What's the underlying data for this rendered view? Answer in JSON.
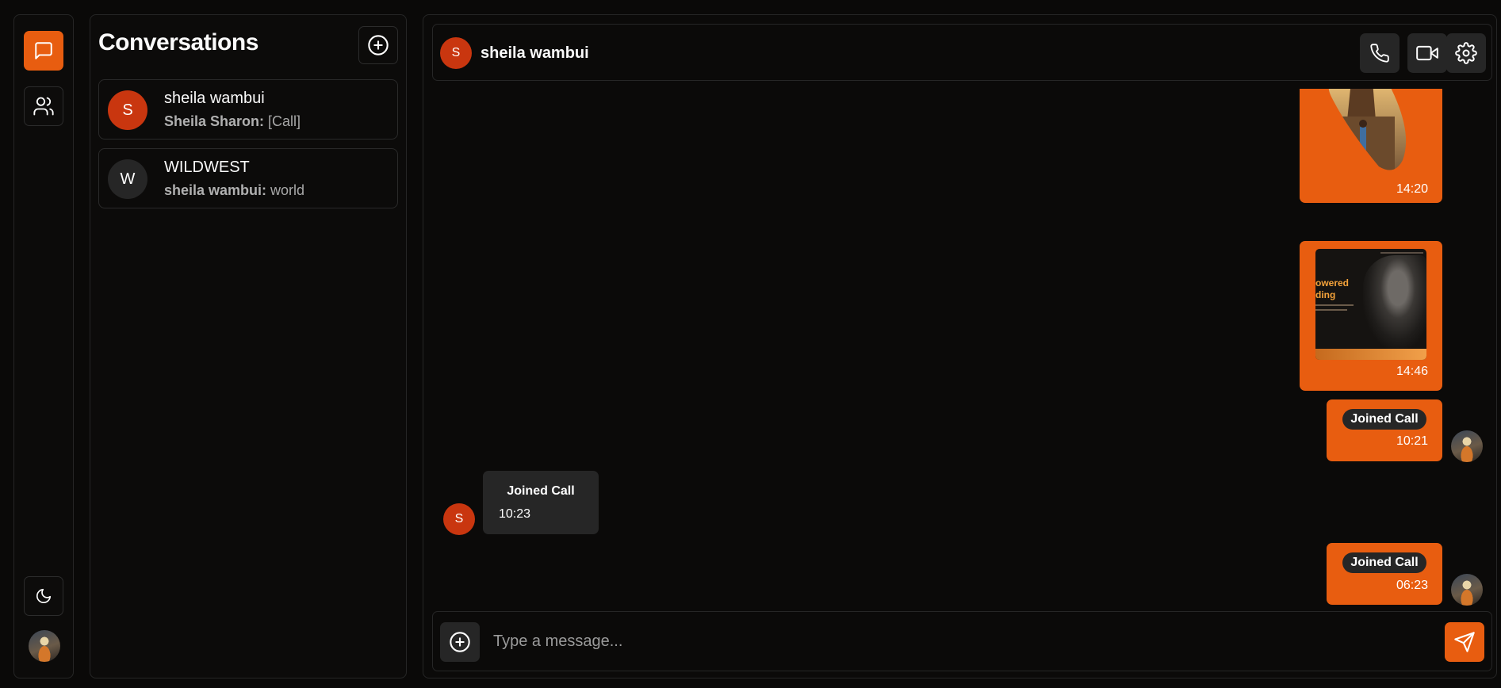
{
  "sidebar": {
    "items": [
      {
        "icon": "message-square-icon",
        "active": true
      },
      {
        "icon": "users-icon",
        "active": false
      }
    ],
    "theme_toggle_icon": "moon-icon",
    "user_avatar": "avatar-image"
  },
  "conversations": {
    "title": "Conversations",
    "add_icon": "plus-circle-icon",
    "items": [
      {
        "initial": "S",
        "name": "sheila wambui",
        "sender": "Sheila Sharon:",
        "preview": " [Call]",
        "avatar_color": "#c9360f"
      },
      {
        "initial": "W",
        "name": "WILDWEST",
        "sender": "sheila wambui:",
        "preview": " world",
        "avatar_color": "#262626"
      }
    ]
  },
  "chat": {
    "header": {
      "initial": "S",
      "name": "sheila wambui",
      "actions": [
        "phone-icon",
        "video-icon",
        "settings-icon"
      ]
    },
    "messages": [
      {
        "direction": "out",
        "type": "image",
        "time": "14:20"
      },
      {
        "direction": "out",
        "type": "image",
        "time": "14:46",
        "image_text": [
          "owered",
          "ding"
        ]
      },
      {
        "direction": "out",
        "type": "call",
        "label": "Joined Call",
        "time": "10:21"
      },
      {
        "direction": "in",
        "type": "call",
        "initial": "S",
        "label": "Joined Call",
        "time": "10:23"
      },
      {
        "direction": "out",
        "type": "call",
        "label": "Joined Call",
        "time": "06:23"
      }
    ],
    "composer": {
      "placeholder": "Type a message...",
      "value": ""
    }
  },
  "colors": {
    "accent": "#e85d10",
    "avatar_red": "#c9360f",
    "surface": "#262626",
    "background": "#0a0908"
  }
}
